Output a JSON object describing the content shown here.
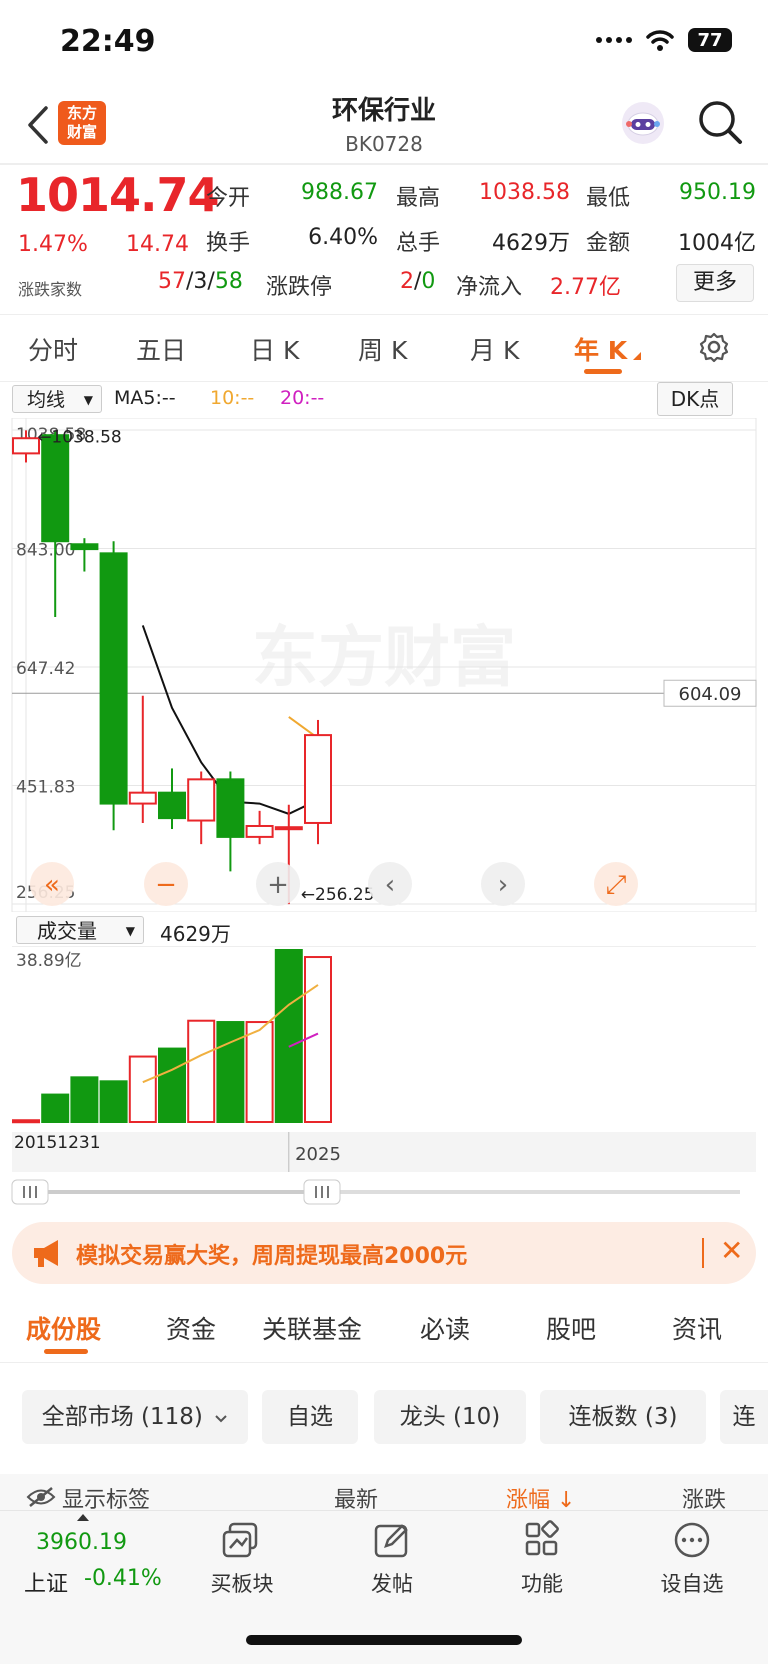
{
  "status": {
    "time": "22:49",
    "battery": "77"
  },
  "header": {
    "logo_line1": "东方",
    "logo_line2": "财富",
    "title": "环保行业",
    "code": "BK0728"
  },
  "quote": {
    "price": "1014.74",
    "change_pct": "1.47%",
    "change_abs": "14.74",
    "stats": [
      {
        "label": "今开",
        "value": "988.67",
        "color": "#119911"
      },
      {
        "label": "最高",
        "value": "1038.58",
        "color": "#e8262a"
      },
      {
        "label": "最低",
        "value": "950.19",
        "color": "#119911"
      },
      {
        "label": "换手",
        "value": "6.40%",
        "color": "#222222"
      },
      {
        "label": "总手",
        "value": "4629万",
        "color": "#222222"
      },
      {
        "label": "金额",
        "value": "1004亿",
        "color": "#222222"
      }
    ],
    "breadth_label": "涨跌家数",
    "breadth_up": "57",
    "breadth_flat": "3",
    "breadth_down": "58",
    "limit_label": "涨跌停",
    "limit_up": "2",
    "limit_down": "0",
    "netflow_label": "净流入",
    "netflow_value": "2.77亿",
    "more": "更多"
  },
  "period_tabs": [
    "分时",
    "五日",
    "日 K",
    "周 K",
    "月 K",
    "年 K"
  ],
  "active_period": "年 K",
  "chart_controls": {
    "ma_select": "均线",
    "ma5": "MA5:--",
    "ma10": "10:--",
    "ma20": "20:--",
    "dk": "DK点",
    "vol_select": "成交量",
    "vol_value": "4629万"
  },
  "chart_data": [
    {
      "type": "candlestick",
      "ylim": [
        256.25,
        1038.58
      ],
      "y_ticks": [
        "1038.58",
        "843.00",
        "647.42",
        "451.83",
        "256.25"
      ],
      "high_marker": "1038.58",
      "low_marker": "256.25",
      "crosshair_label": "604.09",
      "crosshair_value": 604.09,
      "watermark": "东方财富",
      "candles": [
        {
          "o": 1000,
          "c": 1025,
          "h": 1038,
          "l": 985
        },
        {
          "o": 1030,
          "c": 855,
          "h": 1036,
          "l": 730
        },
        {
          "o": 850,
          "c": 842,
          "h": 860,
          "l": 805
        },
        {
          "o": 835,
          "c": 422,
          "h": 855,
          "l": 378
        },
        {
          "o": 422,
          "c": 440,
          "h": 600,
          "l": 390
        },
        {
          "o": 440,
          "c": 398,
          "h": 480,
          "l": 380
        },
        {
          "o": 394,
          "c": 462,
          "h": 475,
          "l": 355
        },
        {
          "o": 462,
          "c": 367,
          "h": 475,
          "l": 310
        },
        {
          "o": 367,
          "c": 385,
          "h": 410,
          "l": 355
        },
        {
          "o": 383,
          "c": 383,
          "h": 420,
          "l": 256
        },
        {
          "o": 390,
          "c": 535,
          "h": 560,
          "l": 355
        }
      ],
      "ma_black": [
        [
          4,
          716
        ],
        [
          5,
          580
        ],
        [
          6,
          490
        ],
        [
          7,
          425
        ],
        [
          8,
          422
        ],
        [
          9,
          405
        ],
        [
          10,
          428
        ]
      ],
      "ma_orange": [
        [
          9,
          565
        ],
        [
          10,
          530
        ]
      ]
    },
    {
      "type": "bar",
      "ylim": [
        0,
        38.89
      ],
      "y_label": "38.89亿",
      "x_labels": [
        "20151231",
        "2025"
      ],
      "colors": [
        "red",
        "green",
        "green",
        "green",
        "red",
        "green",
        "red",
        "green",
        "red",
        "green",
        "red"
      ],
      "values": [
        0.4,
        6.2,
        10.1,
        9.2,
        14.8,
        16.6,
        22.9,
        22.6,
        22.6,
        38.89,
        37.3
      ],
      "ma_orange": [
        [
          4,
          9.0
        ],
        [
          5,
          11.8
        ],
        [
          6,
          15.1
        ],
        [
          7,
          18.0
        ],
        [
          8,
          20.8
        ],
        [
          9,
          26.5
        ],
        [
          10,
          31.0
        ]
      ],
      "ma_magenta": [
        [
          9,
          17.0
        ],
        [
          10,
          20.0
        ]
      ]
    }
  ],
  "promo": {
    "text": "模拟交易赢大奖，周周提现最高2000元"
  },
  "content_tabs": [
    "成份股",
    "资金",
    "关联基金",
    "必读",
    "股吧",
    "资讯"
  ],
  "filters": [
    "全部市场 (118)",
    "自选",
    "龙头 (10)",
    "连板数 (3)",
    "连"
  ],
  "columns": {
    "show_tags": "显示标签",
    "latest": "最新",
    "change": "涨幅",
    "change2": "涨跌"
  },
  "bottom": {
    "index_value": "3960.19",
    "index_name": "上证",
    "index_change": "-0.41%",
    "nav": [
      "买板块",
      "发帖",
      "功能",
      "设自选"
    ]
  },
  "colors": {
    "up": "#e8262a",
    "down": "#119911",
    "accent": "#ee6a1b"
  }
}
